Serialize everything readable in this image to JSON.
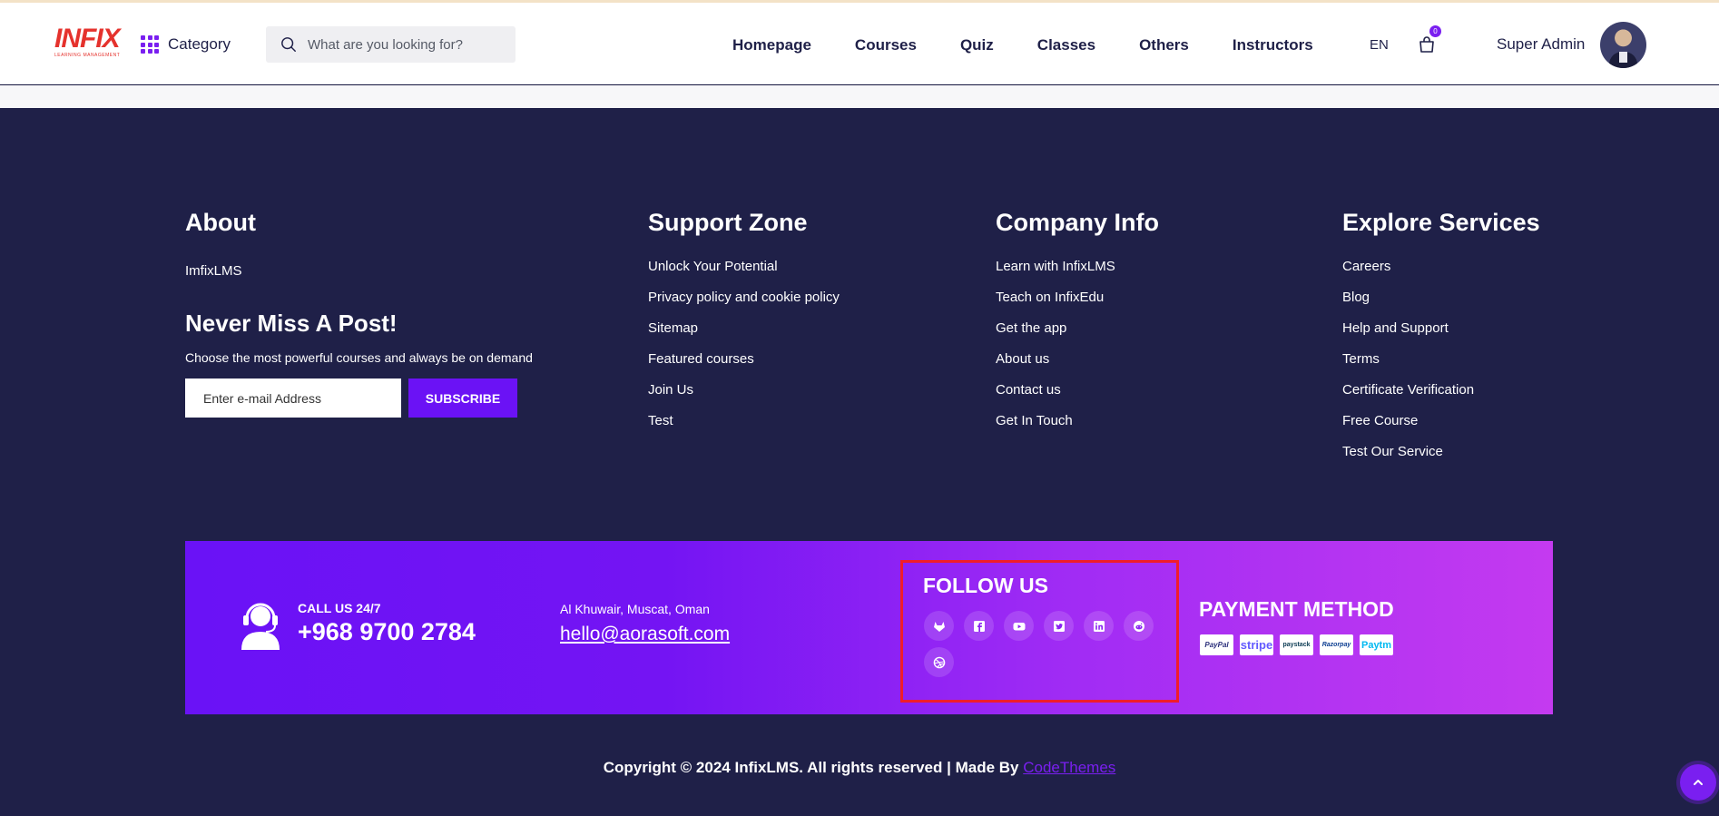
{
  "header": {
    "logo_text": "INFIX",
    "logo_tagline": "LEARNING MANAGEMENT",
    "category_label": "Category",
    "search_placeholder": "What are you looking for?",
    "nav": [
      "Homepage",
      "Courses",
      "Quiz",
      "Classes",
      "Others",
      "Instructors"
    ],
    "language": "EN",
    "cart_count": "0",
    "user_name": "Super Admin"
  },
  "footer": {
    "about": {
      "title": "About",
      "text": "ImfixLMS",
      "newsletter_title": "Never Miss A Post!",
      "newsletter_desc": "Choose the most powerful courses and always be on demand",
      "email_placeholder": "Enter e-mail Address",
      "subscribe_label": "SUBSCRIBE"
    },
    "support_zone": {
      "title": "Support Zone",
      "links": [
        "Unlock Your Potential",
        "Privacy policy and cookie policy",
        "Sitemap",
        "Featured courses",
        "Join Us",
        "Test"
      ]
    },
    "company_info": {
      "title": "Company Info",
      "links": [
        "Learn with InfixLMS",
        "Teach on InfixEdu",
        "Get the app",
        "About us",
        "Contact us",
        "Get In Touch"
      ]
    },
    "explore_services": {
      "title": "Explore Services",
      "links": [
        "Careers",
        "Blog",
        "Help and Support",
        "Terms",
        "Certificate Verification",
        "Free Course",
        "Test Our Service"
      ]
    },
    "band": {
      "call_label": "CALL US 24/7",
      "phone": "+968 9700 2784",
      "address": "Al Khuwair, Muscat, Oman",
      "email": "hello@aorasoft.com",
      "follow_title": "FOLLOW US",
      "social_icons": [
        "gitlab-icon",
        "facebook-icon",
        "youtube-icon",
        "twitter-icon",
        "linkedin-icon",
        "reddit-icon",
        "dribbble-icon"
      ],
      "payment_title": "PAYMENT METHOD",
      "payment_logos": [
        "PayPal",
        "stripe",
        "paystack",
        "Razorpay",
        "Paytm"
      ]
    },
    "copyright_text": "Copyright © 2024 InfixLMS. All rights reserved | Made By",
    "copyright_brand": "CodeThemes"
  },
  "colors": {
    "footer_bg": "#1f2048",
    "accent": "#7a1ff0",
    "band_start": "#6a12f6",
    "band_end": "#c43af0",
    "highlight_border": "#f01d2a"
  }
}
